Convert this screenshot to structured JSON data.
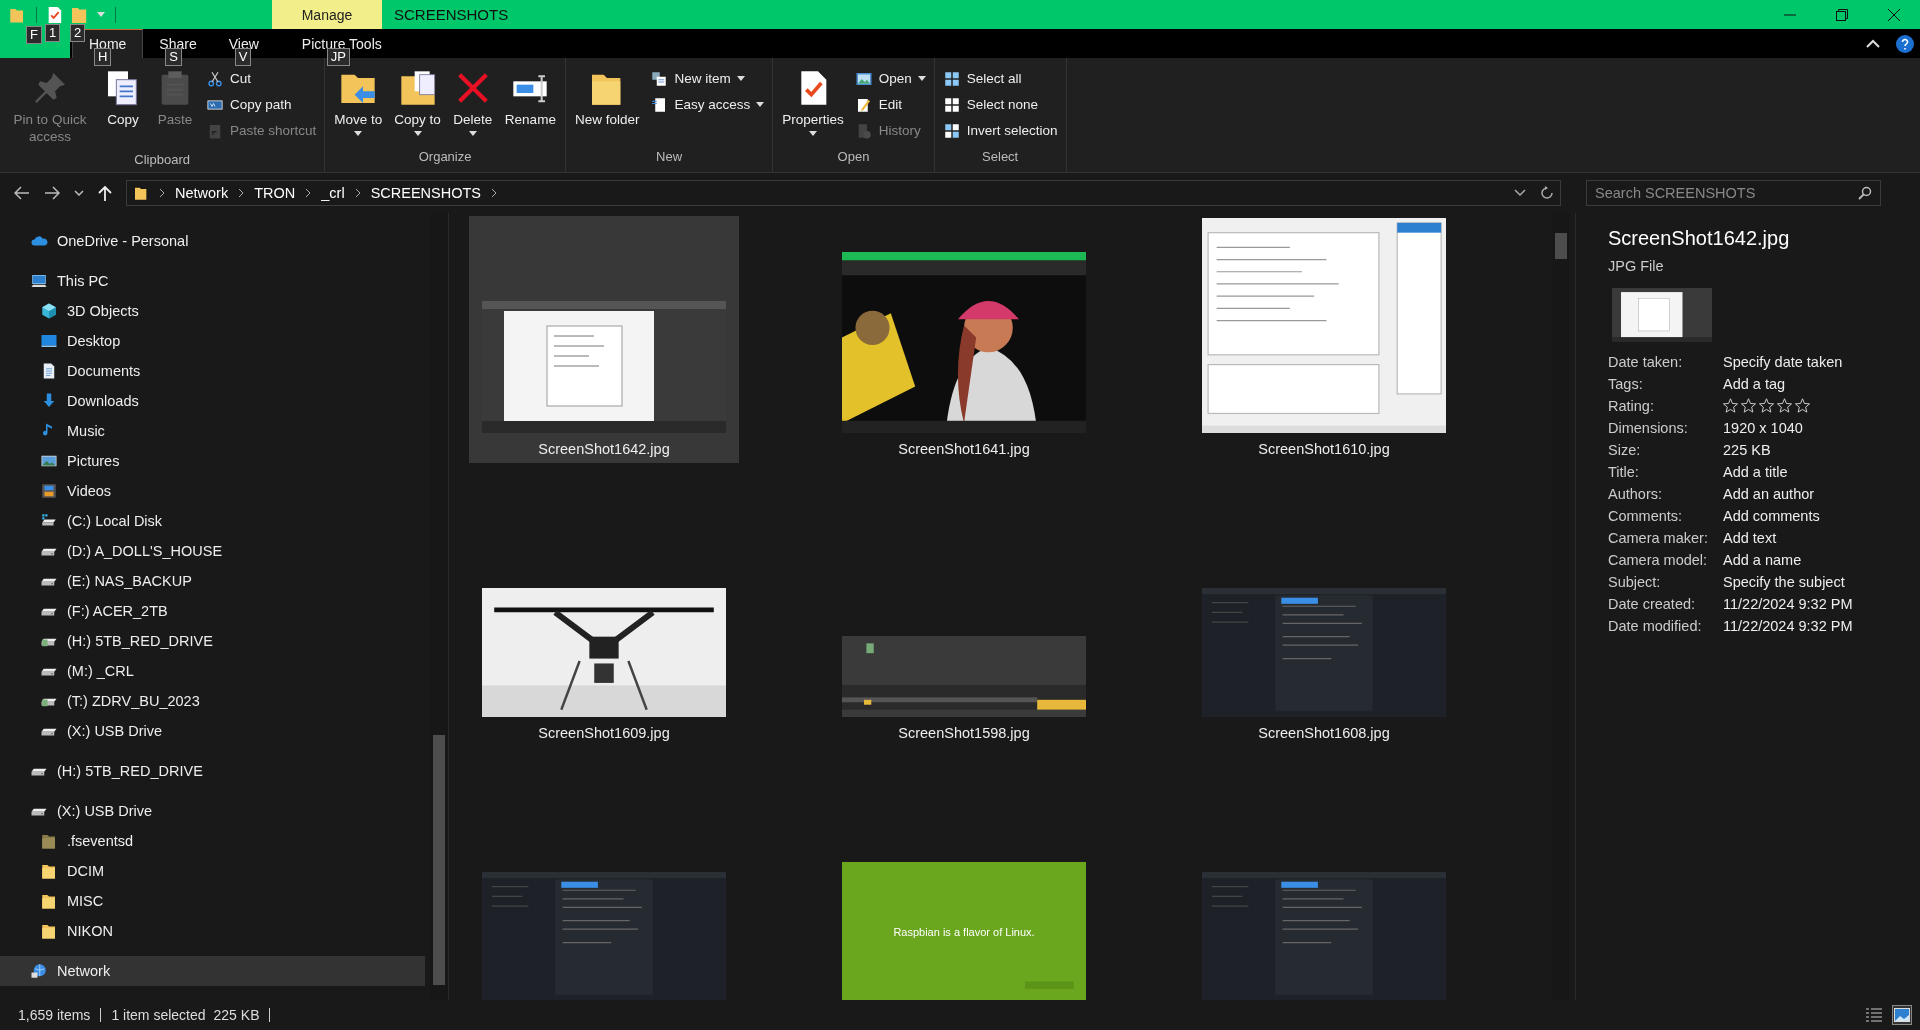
{
  "title_bar": {
    "title": "SCREENSHOTS",
    "context_tab": "Manage",
    "quick_access": [
      {
        "kind": "properties",
        "keytip": "1"
      },
      {
        "kind": "new-folder",
        "keytip": "2"
      }
    ]
  },
  "file_tab": {
    "keytip": "F"
  },
  "ribbon_tabs": [
    {
      "label": "Home",
      "selected": true,
      "keytip": "H"
    },
    {
      "label": "Share",
      "selected": false,
      "keytip": "S"
    },
    {
      "label": "View",
      "selected": false,
      "keytip": "V"
    },
    {
      "label": "Picture Tools",
      "selected": false,
      "keytip": "JP"
    }
  ],
  "ribbon_groups": [
    {
      "label": "Clipboard",
      "buttons": [
        {
          "kind": "pin",
          "label": "Pin to Quick access",
          "disabled": true,
          "dropdown": false
        },
        {
          "kind": "copy",
          "label": "Copy",
          "disabled": false,
          "dropdown": false
        },
        {
          "kind": "paste",
          "label": "Paste",
          "disabled": true,
          "dropdown": false
        }
      ],
      "menu": [
        {
          "kind": "cut",
          "label": "Cut",
          "disabled": false,
          "dropdown": false
        },
        {
          "kind": "copy-path",
          "label": "Copy path",
          "disabled": false,
          "dropdown": false
        },
        {
          "kind": "paste-shortcut",
          "label": "Paste shortcut",
          "disabled": true,
          "dropdown": false
        }
      ]
    },
    {
      "label": "Organize",
      "buttons": [
        {
          "kind": "move",
          "label": "Move to",
          "disabled": false,
          "dropdown": true
        },
        {
          "kind": "copy-to",
          "label": "Copy to",
          "disabled": false,
          "dropdown": true
        },
        {
          "kind": "delete",
          "label": "Delete",
          "disabled": false,
          "dropdown": true
        },
        {
          "kind": "rename",
          "label": "Rename",
          "disabled": false,
          "dropdown": false
        }
      ]
    },
    {
      "label": "New",
      "buttons": [
        {
          "kind": "folder",
          "label": "New folder",
          "disabled": false,
          "dropdown": false
        }
      ],
      "menu": [
        {
          "kind": "new-item",
          "label": "New item",
          "disabled": false,
          "dropdown": true
        },
        {
          "kind": "easy-access",
          "label": "Easy access",
          "disabled": false,
          "dropdown": true
        }
      ]
    },
    {
      "label": "Open",
      "buttons": [
        {
          "kind": "properties",
          "label": "Properties",
          "disabled": false,
          "dropdown": true
        }
      ],
      "menu": [
        {
          "kind": "open",
          "label": "Open",
          "disabled": false,
          "dropdown": true
        },
        {
          "kind": "edit",
          "label": "Edit",
          "disabled": false,
          "dropdown": false
        },
        {
          "kind": "history",
          "label": "History",
          "disabled": true,
          "dropdown": false
        }
      ]
    },
    {
      "label": "Select",
      "menu": [
        {
          "kind": "select-all",
          "label": "Select all",
          "disabled": false,
          "dropdown": false
        },
        {
          "kind": "select-none",
          "label": "Select none",
          "disabled": false,
          "dropdown": false
        },
        {
          "kind": "invert",
          "label": "Invert selection",
          "disabled": false,
          "dropdown": false
        }
      ]
    }
  ],
  "address_bar": {
    "path": [
      "Network",
      "TRON",
      "_crl",
      "SCREENSHOTS"
    ]
  },
  "search": {
    "placeholder": "Search SCREENSHOTS"
  },
  "nav_tree": [
    {
      "label": "OneDrive - Personal",
      "kind": "cloud",
      "selected": false
    },
    {
      "label": "This PC",
      "kind": "pc",
      "selected": false,
      "children": [
        {
          "label": "3D Objects",
          "kind": "cube",
          "selected": false
        },
        {
          "label": "Desktop",
          "kind": "desktop",
          "selected": false
        },
        {
          "label": "Documents",
          "kind": "documents",
          "selected": false
        },
        {
          "label": "Downloads",
          "kind": "downloads",
          "selected": false
        },
        {
          "label": "Music",
          "kind": "music",
          "selected": false
        },
        {
          "label": "Pictures",
          "kind": "pictures",
          "selected": false
        },
        {
          "label": "Videos",
          "kind": "videos",
          "selected": false
        },
        {
          "label": "(C:) Local Disk",
          "kind": "system-drive",
          "selected": false
        },
        {
          "label": "(D:) A_DOLL'S_HOUSE",
          "kind": "drive",
          "selected": false
        },
        {
          "label": "(E:) NAS_BACKUP",
          "kind": "drive",
          "selected": false
        },
        {
          "label": "(F:) ACER_2TB",
          "kind": "drive",
          "selected": false
        },
        {
          "label": "(H:) 5TB_RED_DRIVE",
          "kind": "network-drive",
          "selected": false
        },
        {
          "label": "(M:) _CRL",
          "kind": "drive",
          "selected": false
        },
        {
          "label": "(T:) ZDRV_BU_2023",
          "kind": "network-drive",
          "selected": false
        },
        {
          "label": "(X:) USB Drive",
          "kind": "drive",
          "selected": false
        }
      ]
    },
    {
      "label": "(H:) 5TB_RED_DRIVE",
      "kind": "drive",
      "selected": false
    },
    {
      "label": "(X:) USB Drive",
      "kind": "drive",
      "selected": false,
      "children": [
        {
          "label": ".fseventsd",
          "kind": "hidden-folder",
          "selected": false
        },
        {
          "label": "DCIM",
          "kind": "folder",
          "selected": false
        },
        {
          "label": "MISC",
          "kind": "folder",
          "selected": false
        },
        {
          "label": "NIKON",
          "kind": "folder",
          "selected": false
        }
      ]
    },
    {
      "label": "Network",
      "kind": "network",
      "selected": true
    }
  ],
  "files": [
    {
      "name": "ScreenShot1642.jpg",
      "selected": true,
      "kind": "screenshot-light"
    },
    {
      "name": "ScreenShot1641.jpg",
      "selected": false,
      "kind": "photo-figure"
    },
    {
      "name": "ScreenShot1610.jpg",
      "selected": false,
      "kind": "screenshot-form"
    },
    {
      "name": "ScreenShot1609.jpg",
      "selected": false,
      "kind": "photo-drone"
    },
    {
      "name": "ScreenShot1598.jpg",
      "selected": false,
      "kind": "screenshot-panorama"
    },
    {
      "name": "ScreenShot1608.jpg",
      "selected": false,
      "kind": "screenshot-dark"
    },
    {
      "selected": false,
      "kind": "screenshot-dark"
    },
    {
      "selected": false,
      "kind": "slide",
      "caption": "Raspbian is a flavor of Linux."
    },
    {
      "selected": false,
      "kind": "screenshot-dark"
    }
  ],
  "details": {
    "name": "ScreenShot1642.jpg",
    "type": "JPG File",
    "properties": [
      {
        "label": "Date taken:",
        "value": "Specify date taken"
      },
      {
        "label": "Tags:",
        "value": "Add a tag"
      },
      {
        "label": "Rating:",
        "stars": 0
      },
      {
        "label": "Dimensions:",
        "value": "1920 x 1040"
      },
      {
        "label": "Size:",
        "value": "225 KB"
      },
      {
        "label": "Title:",
        "value": "Add a title"
      },
      {
        "label": "Authors:",
        "value": "Add an author"
      },
      {
        "label": "Comments:",
        "value": "Add comments"
      },
      {
        "label": "Camera maker:",
        "value": "Add text"
      },
      {
        "label": "Camera model:",
        "value": "Add a name"
      },
      {
        "label": "Subject:",
        "value": "Specify the subject"
      },
      {
        "label": "Date created:",
        "value": "11/22/2024 9:32 PM"
      },
      {
        "label": "Date modified:",
        "value": "11/22/2024 9:32 PM"
      }
    ]
  },
  "status_bar": {
    "items": "1,659 items",
    "selection": "1 item selected",
    "size": "225 KB",
    "views": [
      {
        "kind": "details",
        "selected": false
      },
      {
        "kind": "large-icons",
        "selected": true
      }
    ]
  }
}
